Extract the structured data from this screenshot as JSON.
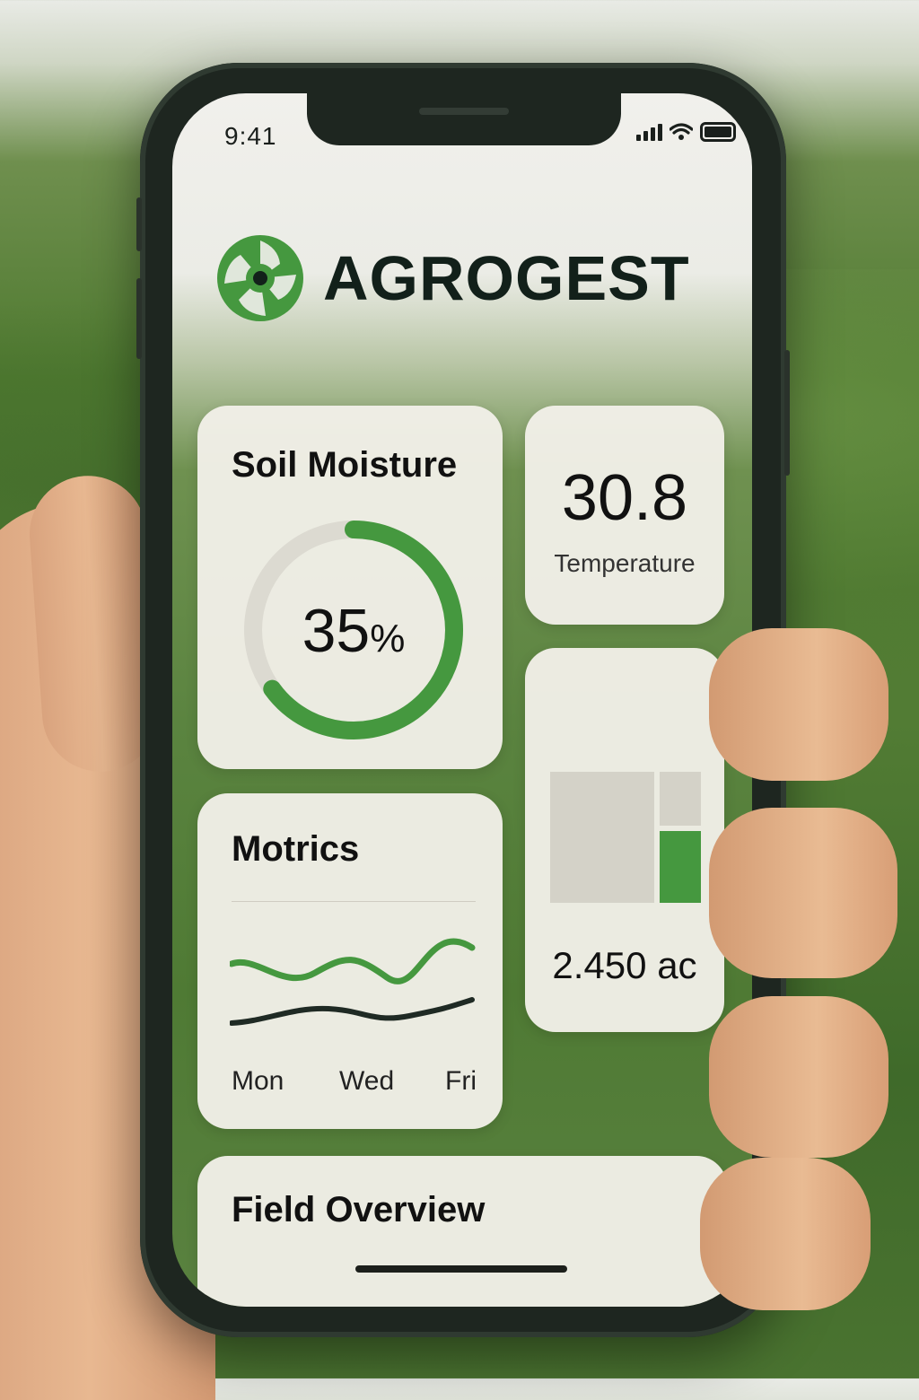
{
  "status_bar": {
    "time": "9:41"
  },
  "brand": {
    "name": "AGROGEST",
    "accent_color": "#45983f"
  },
  "soil_moisture": {
    "title": "Soil Moisture",
    "value": "35",
    "unit": "%",
    "level": 0.65
  },
  "temperature": {
    "value": "30.8",
    "label": "Temperature"
  },
  "area": {
    "value": "2.450 ac"
  },
  "metrics": {
    "title": "Motrics",
    "days": [
      "Mon",
      "Wed",
      "Fri"
    ]
  },
  "field_overview": {
    "title": "Field Overview"
  },
  "icons": [
    "signal-icon",
    "wifi-icon",
    "battery-icon",
    "agrogest-logo-icon"
  ]
}
